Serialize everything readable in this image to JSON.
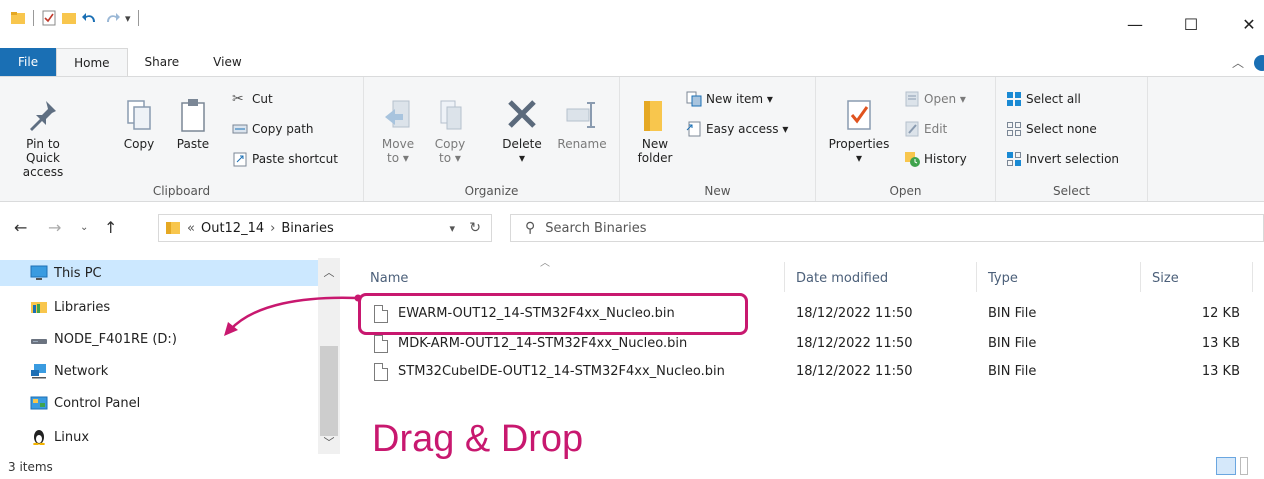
{
  "window": {
    "minimize_glyph": "—",
    "maximize_glyph": "☐",
    "close_glyph": "✕"
  },
  "tabs": [
    {
      "label": "File"
    },
    {
      "label": "Home"
    },
    {
      "label": "Share"
    },
    {
      "label": "View"
    }
  ],
  "ribbon": {
    "clipboard": {
      "label": "Clipboard",
      "pin_label_1": "Pin to Quick",
      "pin_label_2": "access",
      "copy_label": "Copy",
      "paste_label": "Paste",
      "cut_label": "Cut",
      "copy_path_label": "Copy path",
      "paste_shortcut_label": "Paste shortcut"
    },
    "organize": {
      "label": "Organize",
      "move_label_1": "Move",
      "move_label_2": "to ▾",
      "copy_label_1": "Copy",
      "copy_label_2": "to ▾",
      "delete_label_1": "Delete",
      "delete_label_2": "▾",
      "rename_label": "Rename"
    },
    "new": {
      "label": "New",
      "new_folder_1": "New",
      "new_folder_2": "folder",
      "new_item_label": "New item ▾",
      "easy_access_label": "Easy access ▾"
    },
    "open": {
      "label": "Open",
      "properties_1": "Properties",
      "properties_2": "▾",
      "open_label": "Open ▾",
      "edit_label": "Edit",
      "history_label": "History"
    },
    "select": {
      "label": "Select",
      "select_all": "Select all",
      "select_none": "Select none",
      "invert_selection": "Invert selection"
    }
  },
  "address": {
    "overflow": "«",
    "crumb_1": "Out12_14",
    "separator": "›",
    "crumb_2": "Binaries",
    "search_placeholder": "Search Binaries"
  },
  "navpane": {
    "items": [
      {
        "label": "This PC"
      },
      {
        "label": "Libraries"
      },
      {
        "label": "NODE_F401RE (D:)"
      },
      {
        "label": "Network"
      },
      {
        "label": "Control Panel"
      },
      {
        "label": "Linux"
      }
    ]
  },
  "filelist": {
    "columns": {
      "name": "Name",
      "date": "Date modified",
      "type": "Type",
      "size": "Size"
    },
    "rows": [
      {
        "name": "EWARM-OUT12_14-STM32F4xx_Nucleo.bin",
        "date": "18/12/2022 11:50",
        "type": "BIN File",
        "size": "12 KB"
      },
      {
        "name": "MDK-ARM-OUT12_14-STM32F4xx_Nucleo.bin",
        "date": "18/12/2022 11:50",
        "type": "BIN File",
        "size": "13 KB"
      },
      {
        "name": "STM32CubeIDE-OUT12_14-STM32F4xx_Nucleo.bin",
        "date": "18/12/2022 11:50",
        "type": "BIN File",
        "size": "13 KB"
      }
    ]
  },
  "annotation": {
    "text": "Drag & Drop",
    "color": "#c8186f"
  },
  "status": {
    "item_count": "3 items"
  },
  "colors": {
    "accent": "#1a6fb4",
    "selection": "#cce8ff",
    "folder": "#f8c64d"
  }
}
